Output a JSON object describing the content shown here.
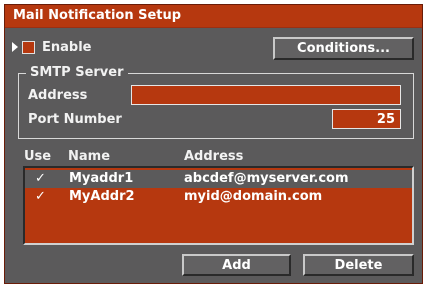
{
  "window": {
    "title": "Mail Notification Setup"
  },
  "enable": {
    "label": "Enable",
    "checked": false
  },
  "conditions_button": {
    "label": "Conditions..."
  },
  "smtp": {
    "legend": "SMTP Server",
    "address_label": "Address",
    "address_value": "",
    "port_label": "Port Number",
    "port_value": "25"
  },
  "table": {
    "headers": {
      "use": "Use",
      "name": "Name",
      "address": "Address"
    },
    "rows": [
      {
        "use": "✓",
        "name": "Myaddr1",
        "address": "abcdef@myserver.com",
        "selected": true
      },
      {
        "use": "✓",
        "name": "MyAddr2",
        "address": "myid@domain.com",
        "selected": false
      }
    ]
  },
  "buttons": {
    "add": "Add",
    "delete": "Delete"
  },
  "colors": {
    "accent": "#b6380f",
    "panel": "#5b5a5b",
    "frame": "#9c2f12"
  }
}
